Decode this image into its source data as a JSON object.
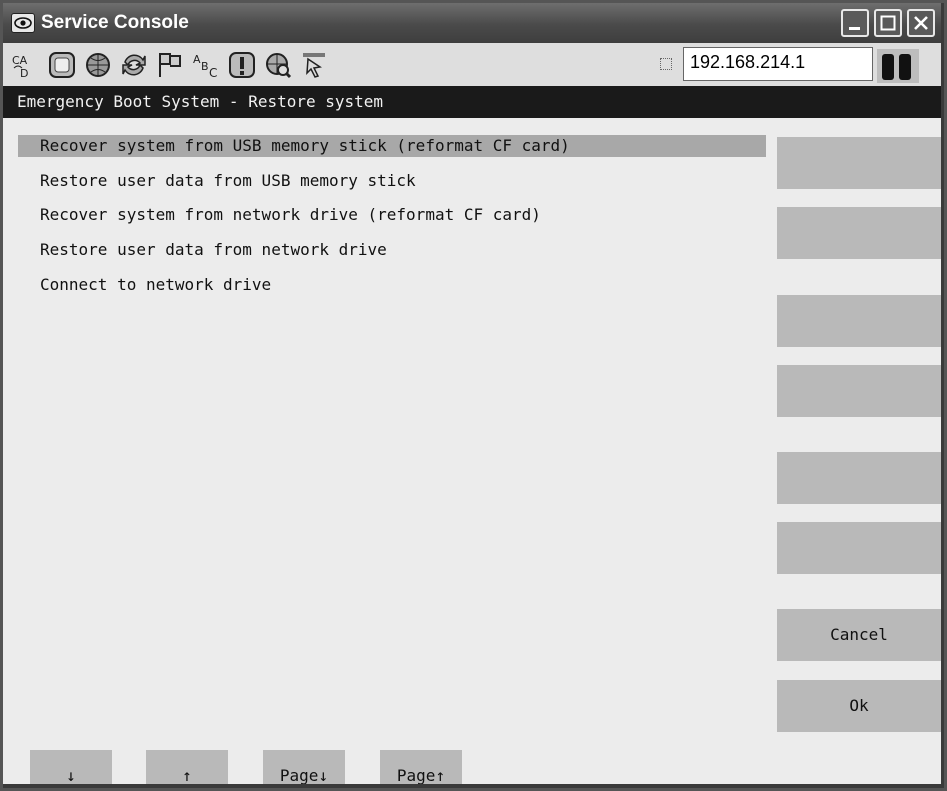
{
  "window": {
    "title": "Service Console",
    "ip_address": "192.168.214.1"
  },
  "toolbar": {
    "icons": [
      "ctrl-alt-del-icon",
      "window-icon",
      "globe-icon",
      "refresh-icon",
      "flags-icon",
      "abc-text-icon",
      "info-icon",
      "globe-search-icon",
      "pointer-icon"
    ]
  },
  "screen": {
    "header": "Emergency Boot System - Restore system",
    "menu": [
      {
        "label": "Recover system from USB memory stick (reformat CF card)",
        "selected": true
      },
      {
        "label": "Restore user data from USB memory stick",
        "selected": false
      },
      {
        "label": "Recover system from network drive (reformat CF card)",
        "selected": false
      },
      {
        "label": "Restore user data from network drive",
        "selected": false
      },
      {
        "label": "Connect to network drive",
        "selected": false
      }
    ],
    "softkeys": {
      "cancel": "Cancel",
      "ok": "Ok"
    },
    "bottom_keys": {
      "down": "↓",
      "up": "↑",
      "page_down": "Page↓",
      "page_up": "Page↑"
    }
  }
}
